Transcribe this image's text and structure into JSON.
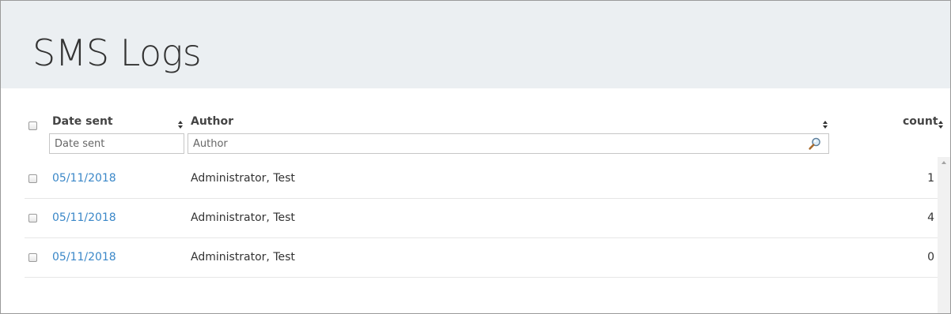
{
  "page": {
    "title": "SMS Logs"
  },
  "table": {
    "columns": {
      "date_sent": {
        "label": "Date sent",
        "filter_placeholder": "Date sent"
      },
      "author": {
        "label": "Author",
        "filter_placeholder": "Author"
      },
      "count": {
        "label": "count"
      }
    },
    "rows": [
      {
        "date_sent": "05/11/2018",
        "author": "Administrator, Test",
        "count": "1"
      },
      {
        "date_sent": "05/11/2018",
        "author": "Administrator, Test",
        "count": "4"
      },
      {
        "date_sent": "05/11/2018",
        "author": "Administrator, Test",
        "count": "0"
      }
    ]
  },
  "colors": {
    "header_background": "#ebeff2",
    "link": "#3a87c8"
  }
}
